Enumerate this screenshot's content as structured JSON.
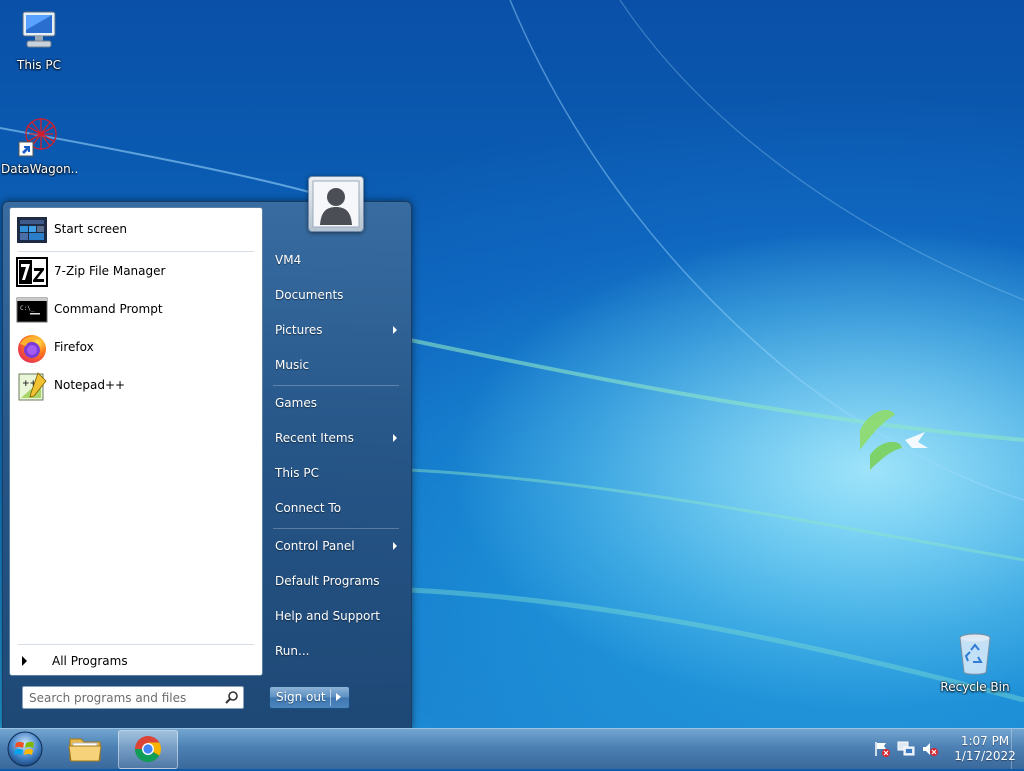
{
  "desktop": {
    "icons": [
      {
        "label": "This PC",
        "icon": "monitor-icon"
      },
      {
        "label": "DataWagon...",
        "icon": "datawagon-shortcut-icon"
      },
      {
        "label": "Recycle Bin",
        "icon": "recycle-bin-icon"
      }
    ]
  },
  "start_menu": {
    "programs": [
      {
        "label": "Start screen",
        "icon": "start-screen-icon"
      },
      {
        "label": "7-Zip File Manager",
        "icon": "7zip-icon"
      },
      {
        "label": "Command Prompt",
        "icon": "cmd-icon"
      },
      {
        "label": "Firefox",
        "icon": "firefox-icon"
      },
      {
        "label": "Notepad++",
        "icon": "notepadpp-icon"
      }
    ],
    "all_programs": "All Programs",
    "search_placeholder": "Search programs and files",
    "right_items": [
      {
        "label": "VM4",
        "submenu": false
      },
      {
        "label": "Documents",
        "submenu": false
      },
      {
        "label": "Pictures",
        "submenu": true
      },
      {
        "label": "Music",
        "submenu": false
      },
      {
        "label": "Games",
        "submenu": false
      },
      {
        "label": "Recent Items",
        "submenu": true
      },
      {
        "label": "This PC",
        "submenu": false
      },
      {
        "label": "Connect To",
        "submenu": false
      },
      {
        "label": "Control Panel",
        "submenu": true
      },
      {
        "label": "Default Programs",
        "submenu": false
      },
      {
        "label": "Help and Support",
        "submenu": false
      },
      {
        "label": "Run...",
        "submenu": false
      }
    ],
    "sign_out": "Sign out"
  },
  "taskbar": {
    "pinned": [
      {
        "name": "file-explorer",
        "icon": "folder-icon",
        "active": false
      },
      {
        "name": "chrome",
        "icon": "chrome-icon",
        "active": true
      }
    ],
    "tray_icons": [
      "action-center-flag-icon",
      "network-icon",
      "volume-muted-icon"
    ],
    "time": "1:07 PM",
    "date": "1/17/2022"
  },
  "colors": {
    "accent": "#1f5f9e",
    "taskbar": "#4f86b8"
  }
}
